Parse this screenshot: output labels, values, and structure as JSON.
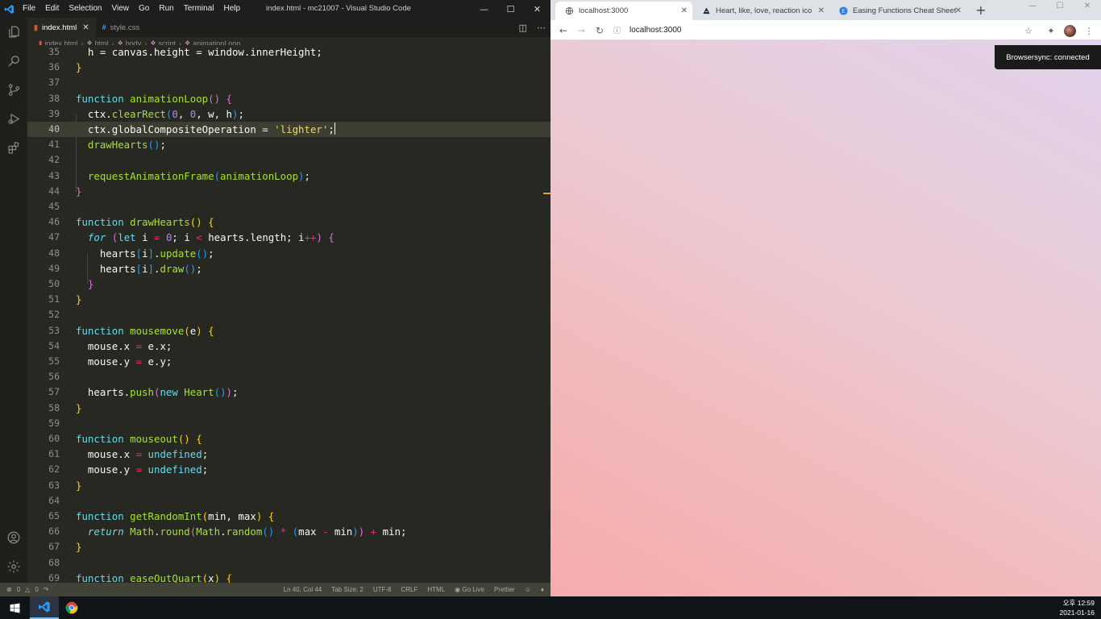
{
  "vscode": {
    "window_title": "index.html - mc21007 - Visual Studio Code",
    "menu": [
      "File",
      "Edit",
      "Selection",
      "View",
      "Go",
      "Run",
      "Terminal",
      "Help"
    ],
    "tabs": [
      {
        "label": "index.html",
        "icon": "html-file-icon",
        "active": true
      },
      {
        "label": "style.css",
        "icon": "css-file-icon",
        "active": false
      }
    ],
    "breadcrumb": [
      "index.html",
      "html",
      "body",
      "script",
      "animationLoop"
    ],
    "cursor_line": 40,
    "status": {
      "errors": "0",
      "warnings": "0",
      "position": "Ln 40, Col 44",
      "tab_size": "Tab Size: 2",
      "encoding": "UTF-8",
      "eol": "CRLF",
      "language": "HTML",
      "go_live": "Go Live",
      "prettier": "Prettier"
    },
    "code_lines": [
      {
        "n": "35",
        "tokens": [
          [
            "plain",
            "  h = canvas.height = window.innerHeight;"
          ]
        ]
      },
      {
        "n": "36",
        "tokens": [
          [
            "par1",
            "}"
          ]
        ]
      },
      {
        "n": "37",
        "tokens": []
      },
      {
        "n": "38",
        "tokens": [
          [
            "kw-fn",
            "function "
          ],
          [
            "fname",
            "animationLoop"
          ],
          [
            "par2",
            "()"
          ],
          [
            "plain",
            " "
          ],
          [
            "par2",
            "{"
          ]
        ]
      },
      {
        "n": "39",
        "tokens": [
          [
            "plain",
            "  ctx."
          ],
          [
            "fname",
            "clearRect"
          ],
          [
            "par3",
            "("
          ],
          [
            "num",
            "0"
          ],
          [
            "plain",
            ", "
          ],
          [
            "num",
            "0"
          ],
          [
            "plain",
            ", w, h"
          ],
          [
            "par3",
            ")"
          ],
          [
            "plain",
            ";"
          ]
        ]
      },
      {
        "n": "40",
        "tokens": [
          [
            "plain",
            "  ctx.globalCompositeOperation = "
          ],
          [
            "str",
            "'lighter'"
          ],
          [
            "plain",
            ";"
          ]
        ]
      },
      {
        "n": "41",
        "tokens": [
          [
            "plain",
            "  "
          ],
          [
            "fname",
            "drawHearts"
          ],
          [
            "par3",
            "()"
          ],
          [
            "plain",
            ";"
          ]
        ]
      },
      {
        "n": "42",
        "tokens": []
      },
      {
        "n": "43",
        "tokens": [
          [
            "plain",
            "  "
          ],
          [
            "fname",
            "requestAnimationFrame"
          ],
          [
            "par3",
            "("
          ],
          [
            "fname",
            "animationLoop"
          ],
          [
            "par3",
            ")"
          ],
          [
            "plain",
            ";"
          ]
        ]
      },
      {
        "n": "44",
        "tokens": [
          [
            "par2",
            "}"
          ]
        ]
      },
      {
        "n": "45",
        "tokens": []
      },
      {
        "n": "46",
        "tokens": [
          [
            "kw-fn",
            "function "
          ],
          [
            "fname",
            "drawHearts"
          ],
          [
            "par1",
            "()"
          ],
          [
            "plain",
            " "
          ],
          [
            "par1",
            "{"
          ]
        ]
      },
      {
        "n": "47",
        "tokens": [
          [
            "plain",
            "  "
          ],
          [
            "kw-i",
            "for"
          ],
          [
            "plain",
            " "
          ],
          [
            "par2",
            "("
          ],
          [
            "kw-fn",
            "let "
          ],
          [
            "plain",
            "i "
          ],
          [
            "kw",
            "="
          ],
          [
            "plain",
            " "
          ],
          [
            "num",
            "0"
          ],
          [
            "plain",
            "; i "
          ],
          [
            "kw",
            "<"
          ],
          [
            "plain",
            " hearts.length; i"
          ],
          [
            "kw",
            "++"
          ],
          [
            "par2",
            ")"
          ],
          [
            "plain",
            " "
          ],
          [
            "par2",
            "{"
          ]
        ]
      },
      {
        "n": "48",
        "tokens": [
          [
            "plain",
            "    hearts"
          ],
          [
            "par3",
            "["
          ],
          [
            "plain",
            "i"
          ],
          [
            "par3",
            "]"
          ],
          [
            "plain",
            "."
          ],
          [
            "fname",
            "update"
          ],
          [
            "par3",
            "()"
          ],
          [
            "plain",
            ";"
          ]
        ]
      },
      {
        "n": "49",
        "tokens": [
          [
            "plain",
            "    hearts"
          ],
          [
            "par3",
            "["
          ],
          [
            "plain",
            "i"
          ],
          [
            "par3",
            "]"
          ],
          [
            "plain",
            "."
          ],
          [
            "fname",
            "draw"
          ],
          [
            "par3",
            "()"
          ],
          [
            "plain",
            ";"
          ]
        ]
      },
      {
        "n": "50",
        "tokens": [
          [
            "plain",
            "  "
          ],
          [
            "par2",
            "}"
          ]
        ]
      },
      {
        "n": "51",
        "tokens": [
          [
            "par1",
            "}"
          ]
        ]
      },
      {
        "n": "52",
        "tokens": []
      },
      {
        "n": "53",
        "tokens": [
          [
            "kw-fn",
            "function "
          ],
          [
            "fname",
            "mousemove"
          ],
          [
            "par1",
            "("
          ],
          [
            "plain",
            "e"
          ],
          [
            "par1",
            ")"
          ],
          [
            "plain",
            " "
          ],
          [
            "par1",
            "{"
          ]
        ]
      },
      {
        "n": "54",
        "tokens": [
          [
            "plain",
            "  mouse.x "
          ],
          [
            "kw",
            "="
          ],
          [
            "plain",
            " e.x;"
          ]
        ]
      },
      {
        "n": "55",
        "tokens": [
          [
            "plain",
            "  mouse.y "
          ],
          [
            "kw",
            "="
          ],
          [
            "plain",
            " e.y;"
          ]
        ]
      },
      {
        "n": "56",
        "tokens": []
      },
      {
        "n": "57",
        "tokens": [
          [
            "plain",
            "  hearts."
          ],
          [
            "fname",
            "push"
          ],
          [
            "par2",
            "("
          ],
          [
            "kw-fn",
            "new "
          ],
          [
            "fname",
            "Heart"
          ],
          [
            "par3",
            "()"
          ],
          [
            "par2",
            ")"
          ],
          [
            "plain",
            ";"
          ]
        ]
      },
      {
        "n": "58",
        "tokens": [
          [
            "par1",
            "}"
          ]
        ]
      },
      {
        "n": "59",
        "tokens": []
      },
      {
        "n": "60",
        "tokens": [
          [
            "kw-fn",
            "function "
          ],
          [
            "fname",
            "mouseout"
          ],
          [
            "par1",
            "()"
          ],
          [
            "plain",
            " "
          ],
          [
            "par1",
            "{"
          ]
        ]
      },
      {
        "n": "61",
        "tokens": [
          [
            "plain",
            "  mouse.x "
          ],
          [
            "kw",
            "="
          ],
          [
            "plain",
            " "
          ],
          [
            "kw-fn",
            "undefined"
          ],
          [
            "plain",
            ";"
          ]
        ]
      },
      {
        "n": "62",
        "tokens": [
          [
            "plain",
            "  mouse.y "
          ],
          [
            "kw",
            "="
          ],
          [
            "plain",
            " "
          ],
          [
            "kw-fn",
            "undefined"
          ],
          [
            "plain",
            ";"
          ]
        ]
      },
      {
        "n": "63",
        "tokens": [
          [
            "par1",
            "}"
          ]
        ]
      },
      {
        "n": "64",
        "tokens": []
      },
      {
        "n": "65",
        "tokens": [
          [
            "kw-fn",
            "function "
          ],
          [
            "fname",
            "getRandomInt"
          ],
          [
            "par1",
            "("
          ],
          [
            "plain",
            "min, max"
          ],
          [
            "par1",
            ")"
          ],
          [
            "plain",
            " "
          ],
          [
            "par1",
            "{"
          ]
        ]
      },
      {
        "n": "66",
        "tokens": [
          [
            "plain",
            "  "
          ],
          [
            "kw-i",
            "return "
          ],
          [
            "fname",
            "Math"
          ],
          [
            "plain",
            "."
          ],
          [
            "fname",
            "round"
          ],
          [
            "par2",
            "("
          ],
          [
            "fname",
            "Math"
          ],
          [
            "plain",
            "."
          ],
          [
            "fname",
            "random"
          ],
          [
            "par3",
            "()"
          ],
          [
            "plain",
            " "
          ],
          [
            "kw",
            "*"
          ],
          [
            "plain",
            " "
          ],
          [
            "par3",
            "("
          ],
          [
            "plain",
            "max "
          ],
          [
            "kw",
            "-"
          ],
          [
            "plain",
            " min"
          ],
          [
            "par3",
            ")"
          ],
          [
            "par2",
            ")"
          ],
          [
            "plain",
            " "
          ],
          [
            "kw",
            "+"
          ],
          [
            "plain",
            " min;"
          ]
        ]
      },
      {
        "n": "67",
        "tokens": [
          [
            "par1",
            "}"
          ]
        ]
      },
      {
        "n": "68",
        "tokens": []
      },
      {
        "n": "69",
        "tokens": [
          [
            "kw-fn",
            "function "
          ],
          [
            "fname",
            "easeOutQuart"
          ],
          [
            "par1",
            "("
          ],
          [
            "plain",
            "x"
          ],
          [
            "par1",
            ")"
          ],
          [
            "plain",
            " "
          ],
          [
            "par1",
            "{"
          ]
        ]
      }
    ]
  },
  "chrome": {
    "tabs": [
      {
        "label": "localhost:3000",
        "icon": "globe-icon",
        "active": true
      },
      {
        "label": "Heart, like, love, reaction icon -",
        "icon": "flaticon-icon",
        "active": false
      },
      {
        "label": "Easing Functions Cheat Sheet",
        "icon": "easings-icon",
        "active": false
      }
    ],
    "url": "localhost:3000",
    "toast": "Browsersync: connected"
  },
  "taskbar": {
    "time": "오후 12:59",
    "date": "2021-01-16"
  },
  "colors": {
    "editor_bg": "#272822",
    "statusbar_bg": "#414339",
    "page_gradient_top": "#e2d2ec",
    "page_gradient_bottom": "#f6acac"
  }
}
